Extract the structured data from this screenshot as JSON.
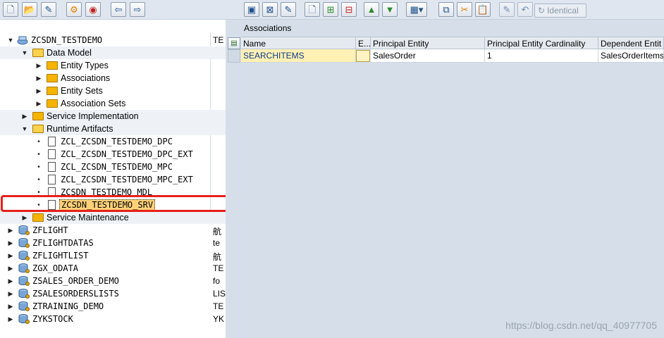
{
  "right_toolbar": {
    "identical_label": "Identical"
  },
  "tree": {
    "project": {
      "label": "ZCSDN_TESTDEMO",
      "desc": "TE"
    },
    "data_model": "Data Model",
    "entity_types": "Entity Types",
    "associations": "Associations",
    "entity_sets": "Entity Sets",
    "association_sets": "Association Sets",
    "service_implementation": "Service Implementation",
    "runtime_artifacts": "Runtime Artifacts",
    "artifacts": [
      "ZCL_ZCSDN_TESTDEMO_DPC",
      "ZCL_ZCSDN_TESTDEMO_DPC_EXT",
      "ZCL_ZCSDN_TESTDEMO_MPC",
      "ZCL_ZCSDN_TESTDEMO_MPC_EXT",
      "ZCSDN_TESTDEMO_MDL",
      "ZCSDN_TESTDEMO_SRV"
    ],
    "service_maintenance": "Service Maintenance",
    "projects": [
      {
        "label": "ZFLIGHT",
        "desc": "航"
      },
      {
        "label": "ZFLIGHTDATAS",
        "desc": "te"
      },
      {
        "label": "ZFLIGHTLIST",
        "desc": "航"
      },
      {
        "label": "ZGX_ODATA",
        "desc": "TE"
      },
      {
        "label": "ZSALES_ORDER_DEMO",
        "desc": "fo"
      },
      {
        "label": "ZSALESORDERSLISTS",
        "desc": "LIS"
      },
      {
        "label": "ZTRAINING_DEMO",
        "desc": "TE"
      },
      {
        "label": "ZYKSTOCK",
        "desc": "YK"
      }
    ]
  },
  "associations_panel": {
    "title": "Associations",
    "columns": [
      "Name",
      "E...",
      "Principal Entity",
      "Principal Entity Cardinality",
      "Dependent Entit"
    ],
    "rows": [
      {
        "name": "SEARCHITEMS",
        "e": "",
        "principal": "SalesOrder",
        "cardinality": "1",
        "dependent": "SalesOrderItems"
      }
    ]
  },
  "watermark": "https://blog.csdn.net/qq_40977705"
}
